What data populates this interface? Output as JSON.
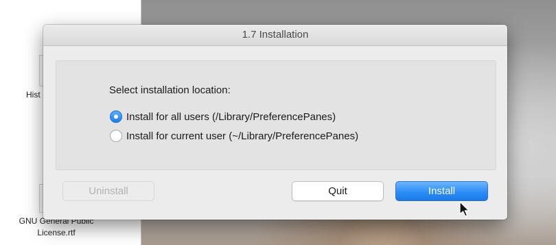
{
  "finder": {
    "partial_label": "Hist",
    "gnu_label_line1": "GNU General Public",
    "gnu_label_line2": "License.rtf"
  },
  "dialog": {
    "title": "1.7 Installation",
    "prompt": "Select installation location:",
    "options": [
      {
        "label": "Install for all users (/Library/PreferencePanes)",
        "selected": true
      },
      {
        "label": "Install for current user (~/Library/PreferencePanes)",
        "selected": false
      }
    ],
    "buttons": {
      "uninstall": {
        "label": "Uninstall",
        "enabled": false
      },
      "quit": {
        "label": "Quit",
        "enabled": true
      },
      "install": {
        "label": "Install",
        "enabled": true,
        "default": true
      }
    }
  },
  "colors": {
    "accent": "#2d8df5",
    "dialog_bg": "#ececec",
    "content_bg": "#e3e3e3"
  },
  "icons": {
    "radio_selected": "radio-selected-icon",
    "radio_unselected": "radio-unselected-icon",
    "cursor": "mouse-pointer-icon"
  }
}
